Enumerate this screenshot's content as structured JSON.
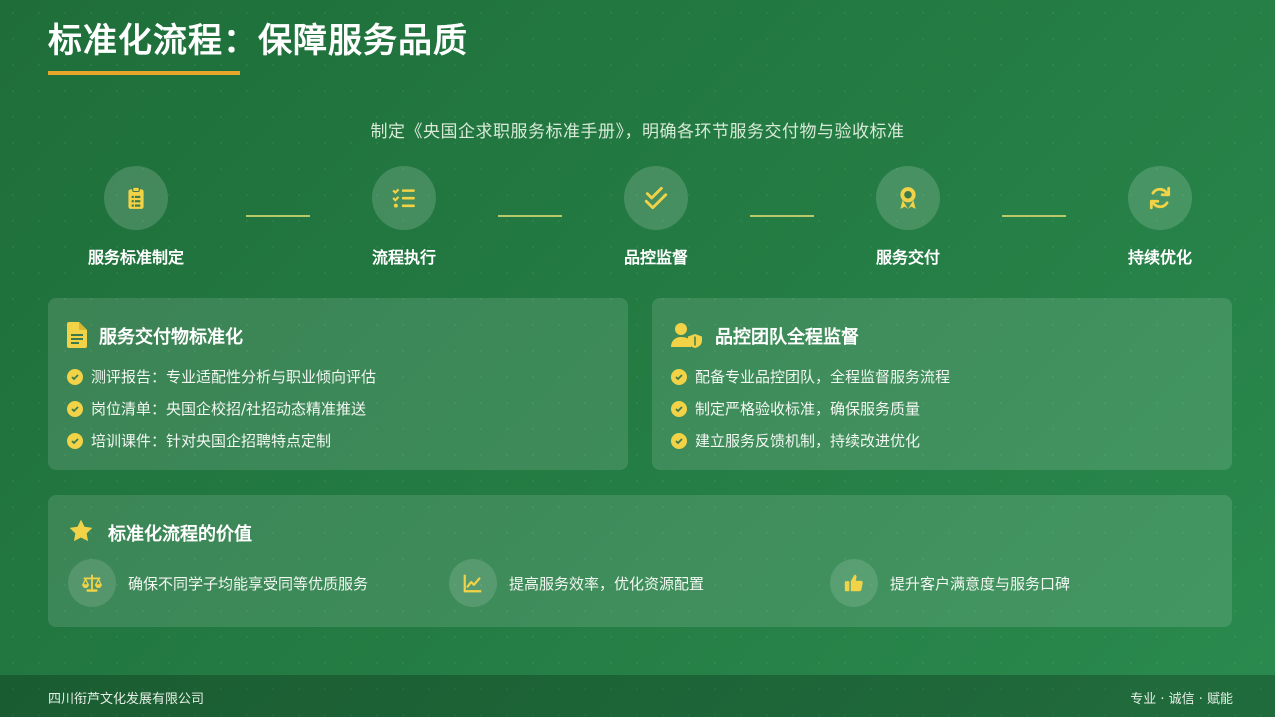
{
  "title": "标准化流程：保障服务品质",
  "subtitle": "制定《央国企求职服务标准手册》，明确各环节服务交付物与验收标准",
  "steps": [
    {
      "label": "服务标准制定",
      "icon": "clipboard-icon"
    },
    {
      "label": "流程执行",
      "icon": "checklist-icon"
    },
    {
      "label": "品控监督",
      "icon": "double-check-icon"
    },
    {
      "label": "服务交付",
      "icon": "award-icon"
    },
    {
      "label": "持续优化",
      "icon": "refresh-icon"
    }
  ],
  "deliverables": {
    "title": "服务交付物标准化",
    "icon": "document-icon",
    "items": [
      "测评报告：专业适配性分析与职业倾向评估",
      "岗位清单：央国企校招/社招动态精准推送",
      "培训课件：针对央国企招聘特点定制"
    ]
  },
  "qc": {
    "title": "品控团队全程监督",
    "icon": "user-shield-icon",
    "items": [
      "配备专业品控团队，全程监督服务流程",
      "制定严格验收标准，确保服务质量",
      "建立服务反馈机制，持续改进优化"
    ]
  },
  "value": {
    "title": "标准化流程的价值",
    "icon": "star-icon",
    "items": [
      {
        "text": "确保不同学子均能享受同等优质服务",
        "icon": "balance-scale-icon"
      },
      {
        "text": "提高服务效率，优化资源配置",
        "icon": "line-chart-icon"
      },
      {
        "text": "提升客户满意度与服务口碑",
        "icon": "thumbs-up-icon"
      }
    ]
  },
  "footer": {
    "company": "四川衔芦文化发展有限公司",
    "slogan": "专业 · 诚信 · 赋能"
  },
  "colors": {
    "accent_yellow": "#f2d348",
    "underline_orange": "#e8a52c",
    "connector": "#b7c96a",
    "background": "#237a42"
  }
}
